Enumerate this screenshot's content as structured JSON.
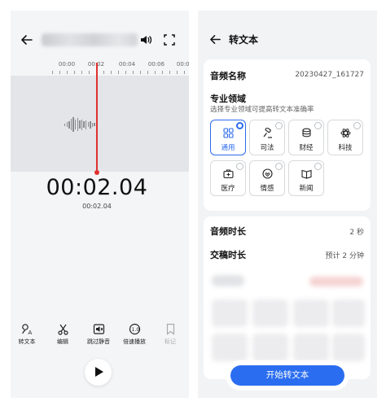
{
  "left": {
    "ruler_ticks": [
      "00:00",
      "00:02",
      "00:04",
      "00:06",
      "00:08"
    ],
    "time_big": "00:02.04",
    "time_small": "00:02.04",
    "toolbar": [
      {
        "label": "转文本",
        "icon": "transcribe-icon",
        "enabled": true
      },
      {
        "label": "编辑",
        "icon": "edit-scissors-icon",
        "enabled": true
      },
      {
        "label": "跳过静音",
        "icon": "skip-silence-icon",
        "enabled": true
      },
      {
        "label": "倍速播放",
        "icon": "speed-icon",
        "enabled": true
      },
      {
        "label": "标记",
        "icon": "bookmark-icon",
        "enabled": false
      }
    ],
    "playhead_color": "#e0312f"
  },
  "right": {
    "title": "转文本",
    "audio_name_label": "音频名称",
    "audio_name_value": "20230427_161727",
    "domain_label": "专业领域",
    "domain_hint": "选择专业领域可提高转文本准确率",
    "domains": [
      {
        "label": "通用",
        "icon": "grid-icon",
        "selected": true
      },
      {
        "label": "司法",
        "icon": "gavel-icon",
        "selected": false
      },
      {
        "label": "财经",
        "icon": "coins-icon",
        "selected": false
      },
      {
        "label": "科技",
        "icon": "atom-icon",
        "selected": false
      },
      {
        "label": "医疗",
        "icon": "medical-kit-icon",
        "selected": false
      },
      {
        "label": "情感",
        "icon": "emotion-icon",
        "selected": false
      },
      {
        "label": "新闻",
        "icon": "newspaper-icon",
        "selected": false
      }
    ],
    "duration_label": "音频时长",
    "duration_value": "2 秒",
    "delivery_label": "交稿时长",
    "delivery_value": "预计 2 分钟",
    "start_button": "开始转文本",
    "accent_color": "#2a6df0"
  }
}
